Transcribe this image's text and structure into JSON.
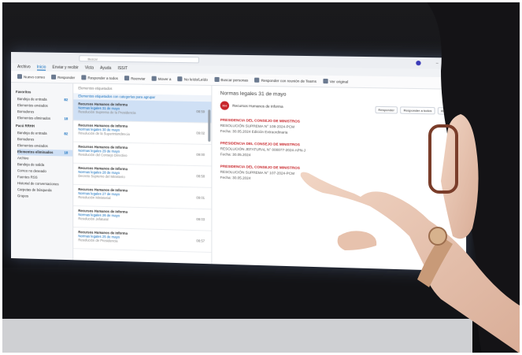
{
  "outlook": {
    "search_placeholder": "Buscar",
    "menu": [
      "Archivo",
      "Inicio",
      "Enviar y recibir",
      "Vista",
      "Ayuda",
      "ISSIT"
    ],
    "ribbon": [
      {
        "label": "Nuevo correo",
        "icon": "new-mail-icon"
      },
      {
        "label": "Responder",
        "icon": "reply-icon"
      },
      {
        "label": "Responder a todos",
        "icon": "reply-all-icon"
      },
      {
        "label": "Reenviar",
        "icon": "forward-icon"
      },
      {
        "label": "Mover a",
        "icon": "move-icon"
      },
      {
        "label": "No leído/Leído",
        "icon": "read-icon"
      },
      {
        "label": "Buscar personas",
        "icon": "people-icon"
      },
      {
        "label": "Responder con reunión de Teams",
        "icon": "teams-icon"
      },
      {
        "label": "Ver original",
        "icon": "view-icon"
      }
    ],
    "folders": {
      "favorites_header": "Favoritos",
      "favorites": [
        {
          "label": "Bandeja de entrada",
          "count": "82"
        },
        {
          "label": "Elementos enviados",
          "count": ""
        },
        {
          "label": "Borradores",
          "count": ""
        },
        {
          "label": "Elementos eliminados",
          "count": "18"
        }
      ],
      "account_header": "Pacú RRHH",
      "account": [
        {
          "label": "Bandeja de entrada",
          "count": "82"
        },
        {
          "label": "Borradores",
          "count": ""
        },
        {
          "label": "Elementos enviados",
          "count": ""
        },
        {
          "label": "Elementos eliminados",
          "count": "18"
        },
        {
          "label": "Archivo",
          "count": ""
        },
        {
          "label": "Bandeja de salida",
          "count": ""
        },
        {
          "label": "Correo no deseado",
          "count": ""
        },
        {
          "label": "Fuentes RSS",
          "count": ""
        },
        {
          "label": "Historial de conversaciones",
          "count": ""
        },
        {
          "label": "Carpetas de búsqueda",
          "count": ""
        },
        {
          "label": "Grupos",
          "count": ""
        }
      ]
    },
    "list": {
      "header": "Elementos etiquetados",
      "banner": "Elementos etiquetados con categorías para agrupar",
      "rows": [
        {
          "from": "Recursos Humanos de Informa",
          "subject": "Normas legales 31 de mayo",
          "preview": "Resolución Suprema de la Presidencia",
          "time": "08:59"
        },
        {
          "from": "Recursos Humanos de Informa",
          "subject": "Normas legales 30 de mayo",
          "preview": "Resolución de la Superintendencia",
          "time": "09:02"
        },
        {
          "from": "Recursos Humanos de Informa",
          "subject": "Normas legales 29 de mayo",
          "preview": "Resolución del Consejo Directivo",
          "time": "09:00"
        },
        {
          "from": "Recursos Humanos de Informa",
          "subject": "Normas legales 28 de mayo",
          "preview": "Decreto Supremo del Ministerio",
          "time": "08:58"
        },
        {
          "from": "Recursos Humanos de Informa",
          "subject": "Normas legales 27 de mayo",
          "preview": "Resolución Ministerial",
          "time": "09:01"
        },
        {
          "from": "Recursos Humanos de Informa",
          "subject": "Normas legales 26 de mayo",
          "preview": "Resolución Jefatural",
          "time": "09:03"
        },
        {
          "from": "Recursos Humanos de Informa",
          "subject": "Normas legales 25 de mayo",
          "preview": "Resolución de Presidencia",
          "time": "08:57"
        }
      ]
    },
    "reader": {
      "subject": "Normas legales 31 de mayo",
      "avatar_initials": "RH",
      "sender": "Recursos Humanos de Informa",
      "actions": [
        "Responder",
        "Responder a todos",
        "Reenviar"
      ],
      "sections": [
        {
          "heading": "PRESIDENCIA DEL CONSEJO DE MINISTROS",
          "line1": "RESOLUCIÓN SUPREMA N° 108-2024-PCM",
          "line2": "Fecha: 30.05.2024 Edición Extraordinaria"
        },
        {
          "heading": "PRESIDENCIA DEL CONSEJO DE MINISTROS",
          "line1": "RESOLUCIÓN JEFATURAL N° 000077-2024-APN-J",
          "line2": "Fecha: 30.05.2024"
        },
        {
          "heading": "PRESIDENCIA DEL CONSEJO DE MINISTROS",
          "line1": "RESOLUCIÓN SUPREMA N° 107-2024-PCM",
          "line2": "Fecha: 30.05.2024"
        }
      ]
    }
  }
}
